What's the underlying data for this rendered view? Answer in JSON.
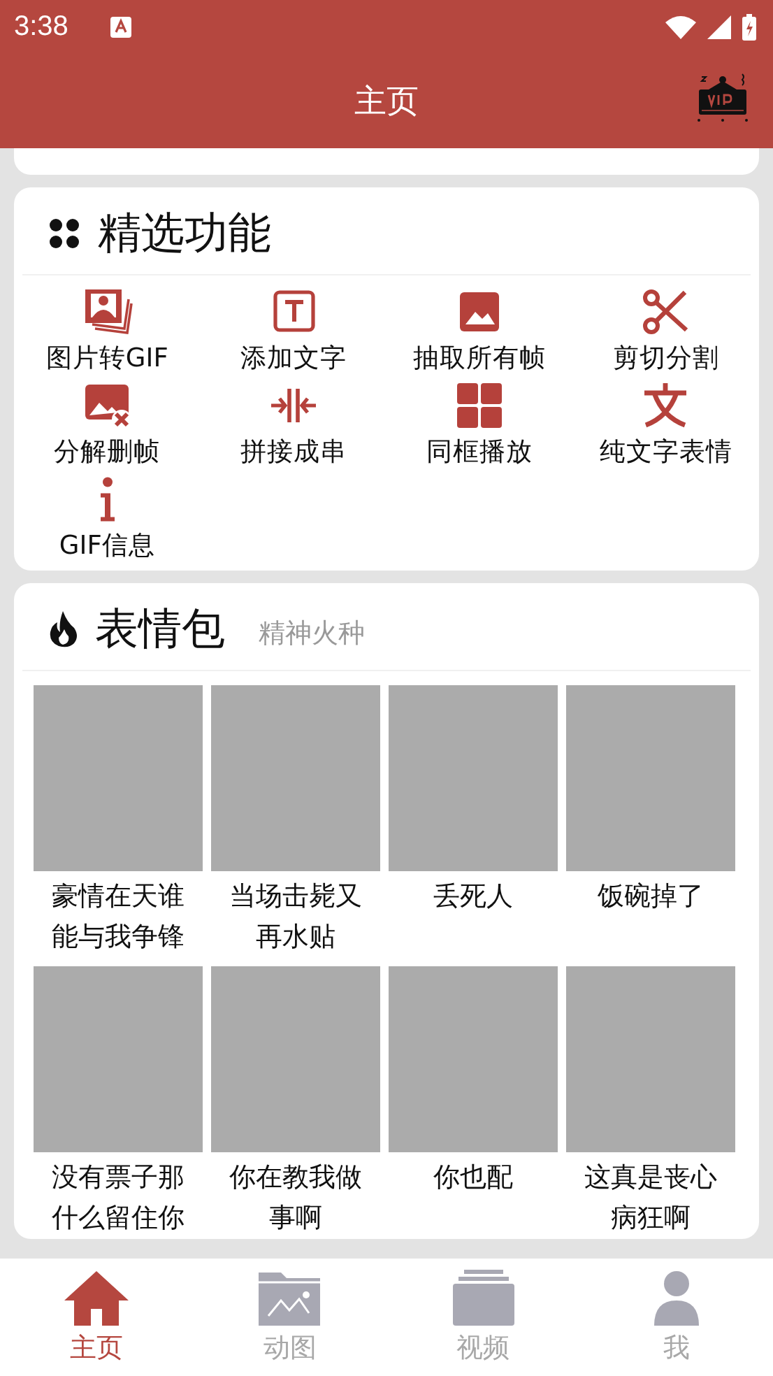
{
  "status_bar": {
    "time": "3:38"
  },
  "app_bar": {
    "title": "主页"
  },
  "featured": {
    "title": "精选功能",
    "items": [
      {
        "label": "图片转GIF",
        "kind": "photos"
      },
      {
        "label": "添加文字",
        "kind": "textbox"
      },
      {
        "label": "抽取所有帧",
        "kind": "image"
      },
      {
        "label": "剪切分割",
        "kind": "scissors"
      },
      {
        "label": "分解删帧",
        "kind": "imagex"
      },
      {
        "label": "拼接成串",
        "kind": "merge"
      },
      {
        "label": "同框播放",
        "kind": "grid"
      },
      {
        "label": "纯文字表情",
        "kind": "wen"
      },
      {
        "label": "GIF信息",
        "kind": "info"
      }
    ]
  },
  "stickers": {
    "title": "表情包",
    "subtitle": "精神火种",
    "items": [
      {
        "caption": "豪情在天谁能与我争锋"
      },
      {
        "caption": "当场击毙又再水贴"
      },
      {
        "caption": "丢死人"
      },
      {
        "caption": "饭碗掉了"
      },
      {
        "caption": "没有票子那什么留住你"
      },
      {
        "caption": "你在教我做事啊"
      },
      {
        "caption": "你也配"
      },
      {
        "caption": "这真是丧心病狂啊"
      }
    ]
  },
  "tabs": [
    {
      "label": "主页",
      "kind": "home",
      "selected": true
    },
    {
      "label": "动图",
      "kind": "folder",
      "selected": false
    },
    {
      "label": "视频",
      "kind": "video",
      "selected": false
    },
    {
      "label": "我",
      "kind": "person",
      "selected": false
    }
  ]
}
